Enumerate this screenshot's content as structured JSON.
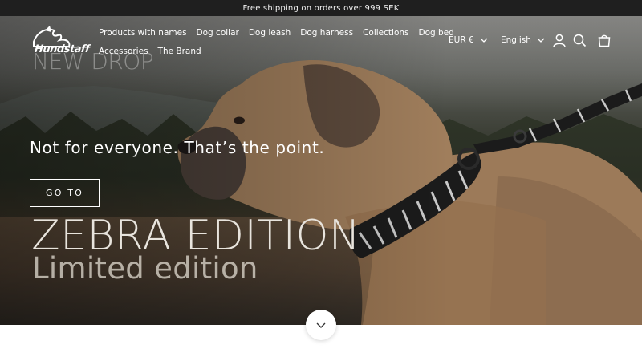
{
  "announcement": "Free shipping on orders over 999 SEK",
  "brand": {
    "logo_text": "Hundstaff"
  },
  "nav": {
    "row1": [
      "Products with names",
      "Dog collar",
      "Dog leash",
      "Dog harness",
      "Collections",
      "Dog bed"
    ],
    "row2": [
      "Accessories",
      "The Brand"
    ]
  },
  "utilities": {
    "currency": "EUR €",
    "language": "English",
    "icons": [
      "account-icon",
      "search-icon",
      "cart-icon"
    ]
  },
  "hero": {
    "kicker": "NEW DROP",
    "tagline": "Not for everyone. That’s the point.",
    "cta_label": "GO TO",
    "headline": "ZEBRA EDITION",
    "subhead": "Limited edition"
  },
  "colors": {
    "announcement_bg": "#1f1f1f",
    "text_light": "#ffffff",
    "headline": "#e8e4dd"
  }
}
